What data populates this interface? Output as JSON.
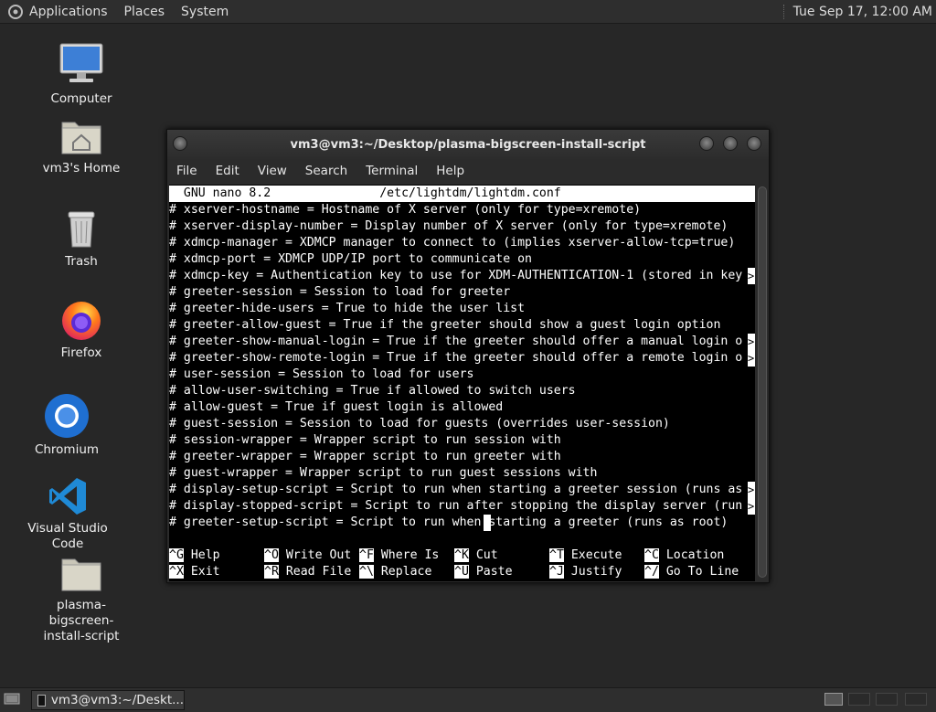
{
  "top_panel": {
    "menus": [
      "Applications",
      "Places",
      "System"
    ],
    "clock": "Tue Sep 17, 12:00 AM"
  },
  "desktop_icons": [
    {
      "label": "Computer",
      "icon": "computer-icon"
    },
    {
      "label": "vm3's Home",
      "icon": "home-folder-icon"
    },
    {
      "label": "Trash",
      "icon": "trash-icon"
    },
    {
      "label": "Firefox",
      "icon": "firefox-icon"
    },
    {
      "label": "Chromium",
      "icon": "chromium-icon"
    },
    {
      "label": "Visual Studio Code",
      "icon": "vscode-icon"
    },
    {
      "label": "plasma-bigscreen-install-script",
      "label_lines": [
        "plasma-bigscreen-",
        "install-script"
      ],
      "icon": "folder-icon"
    }
  ],
  "window": {
    "title": "vm3@vm3:~/Desktop/plasma-bigscreen-install-script",
    "menus": [
      "File",
      "Edit",
      "View",
      "Search",
      "Terminal",
      "Help"
    ]
  },
  "nano": {
    "header": "  GNU nano 8.2               /etc/lightdm/lightdm.conf",
    "lines": [
      "# xserver-hostname = Hostname of X server (only for type=xremote)",
      "# xserver-display-number = Display number of X server (only for type=xremote)",
      "# xdmcp-manager = XDMCP manager to connect to (implies xserver-allow-tcp=true)",
      "# xdmcp-port = XDMCP UDP/IP port to communicate on",
      "# xdmcp-key = Authentication key to use for XDM-AUTHENTICATION-1 (stored in key",
      "# greeter-session = Session to load for greeter",
      "# greeter-hide-users = True to hide the user list",
      "# greeter-allow-guest = True if the greeter should show a guest login option",
      "# greeter-show-manual-login = True if the greeter should offer a manual login o",
      "# greeter-show-remote-login = True if the greeter should offer a remote login o",
      "# user-session = Session to load for users",
      "# allow-user-switching = True if allowed to switch users",
      "# allow-guest = True if guest login is allowed",
      "# guest-session = Session to load for guests (overrides user-session)",
      "# session-wrapper = Wrapper script to run session with",
      "# greeter-wrapper = Wrapper script to run greeter with",
      "# guest-wrapper = Wrapper script to run guest sessions with",
      "# display-setup-script = Script to run when starting a greeter session (runs as",
      "# display-stopped-script = Script to run after stopping the display server (run",
      "# greeter-setup-script = Script to run when starting a greeter (runs as root)"
    ],
    "truncated_lines": [
      4,
      8,
      9,
      17,
      18
    ],
    "cursor": {
      "line": 19,
      "col": 43
    },
    "shortcuts_row1": [
      {
        "key": "^G",
        "label": "Help"
      },
      {
        "key": "^O",
        "label": "Write Out"
      },
      {
        "key": "^F",
        "label": "Where Is"
      },
      {
        "key": "^K",
        "label": "Cut"
      },
      {
        "key": "^T",
        "label": "Execute"
      },
      {
        "key": "^C",
        "label": "Location"
      }
    ],
    "shortcuts_row2": [
      {
        "key": "^X",
        "label": "Exit"
      },
      {
        "key": "^R",
        "label": "Read File"
      },
      {
        "key": "^\\",
        "label": "Replace"
      },
      {
        "key": "^U",
        "label": "Paste"
      },
      {
        "key": "^J",
        "label": "Justify"
      },
      {
        "key": "^/",
        "label": "Go To Line"
      }
    ]
  },
  "bottom_panel": {
    "task_label": "vm3@vm3:~/Deskt..."
  }
}
